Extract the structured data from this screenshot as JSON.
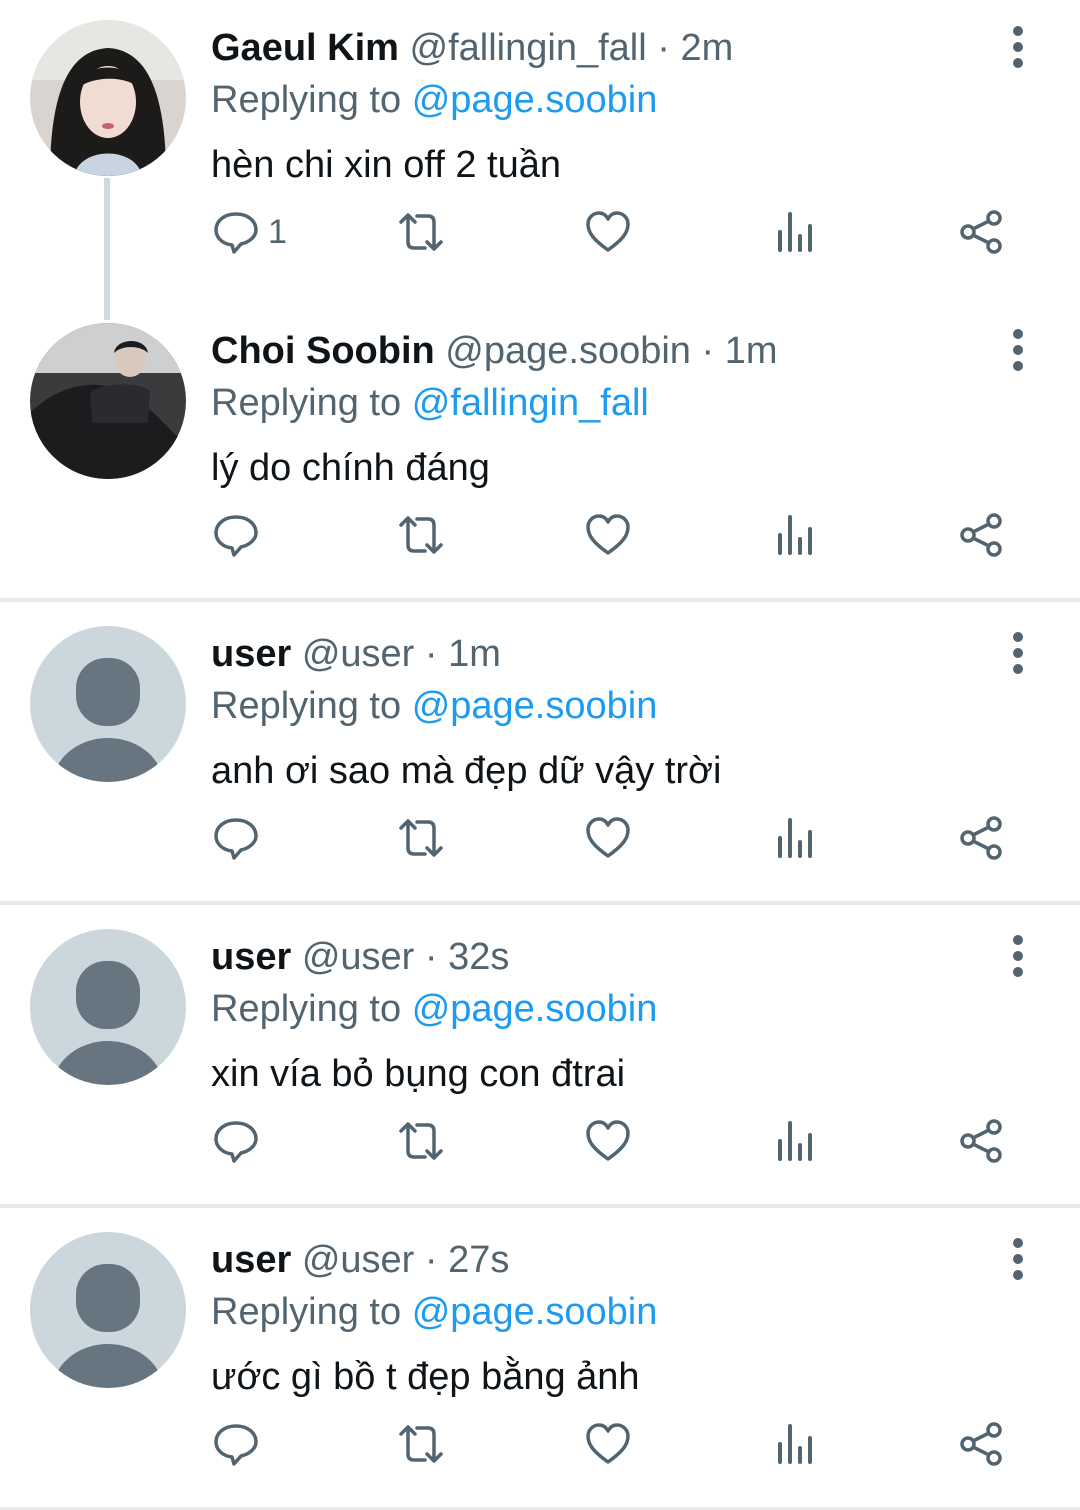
{
  "colors": {
    "link": "#1d9bf0",
    "secondary_text": "#536471",
    "primary_text": "#0f1419",
    "divider": "#e7e9ea",
    "thread_line": "#cfd9de",
    "default_avatar_bg": "#ccd6dd",
    "default_avatar_fg": "#66757f"
  },
  "icons": {
    "reply": "chat-bubble-icon",
    "retweet": "retweet-icon",
    "like": "heart-icon",
    "views": "bar-chart-icon",
    "share": "share-icon",
    "more": "vertical-dots-icon"
  },
  "tweets": [
    {
      "display_name": "Gaeul Kim",
      "handle": "@fallingin_fall",
      "time_sep": "·",
      "time": "2m",
      "replying_prefix": "Replying to",
      "replying_to": "@page.soobin",
      "text": "hèn chi xin off 2 tuần",
      "reply_count": "1",
      "avatar": "photo"
    },
    {
      "display_name": "Choi Soobin",
      "handle": "@page.soobin",
      "time_sep": "·",
      "time": "1m",
      "replying_prefix": "Replying to",
      "replying_to": "@fallingin_fall",
      "text": "lý do chính đáng",
      "reply_count": "",
      "avatar": "photo"
    },
    {
      "display_name": "user",
      "handle": "@user",
      "time_sep": "·",
      "time": "1m",
      "replying_prefix": "Replying to",
      "replying_to": "@page.soobin",
      "text": "anh ơi sao mà đẹp dữ vậy trời",
      "reply_count": "",
      "avatar": "default"
    },
    {
      "display_name": "user",
      "handle": "@user",
      "time_sep": "·",
      "time": "32s",
      "replying_prefix": "Replying to",
      "replying_to": "@page.soobin",
      "text": "xin vía bỏ bụng con đtrai",
      "reply_count": "",
      "avatar": "default"
    },
    {
      "display_name": "user",
      "handle": "@user",
      "time_sep": "·",
      "time": "27s",
      "replying_prefix": "Replying to",
      "replying_to": "@page.soobin",
      "text": "ước gì bồ t đẹp bằng ảnh",
      "reply_count": "",
      "avatar": "default"
    }
  ]
}
